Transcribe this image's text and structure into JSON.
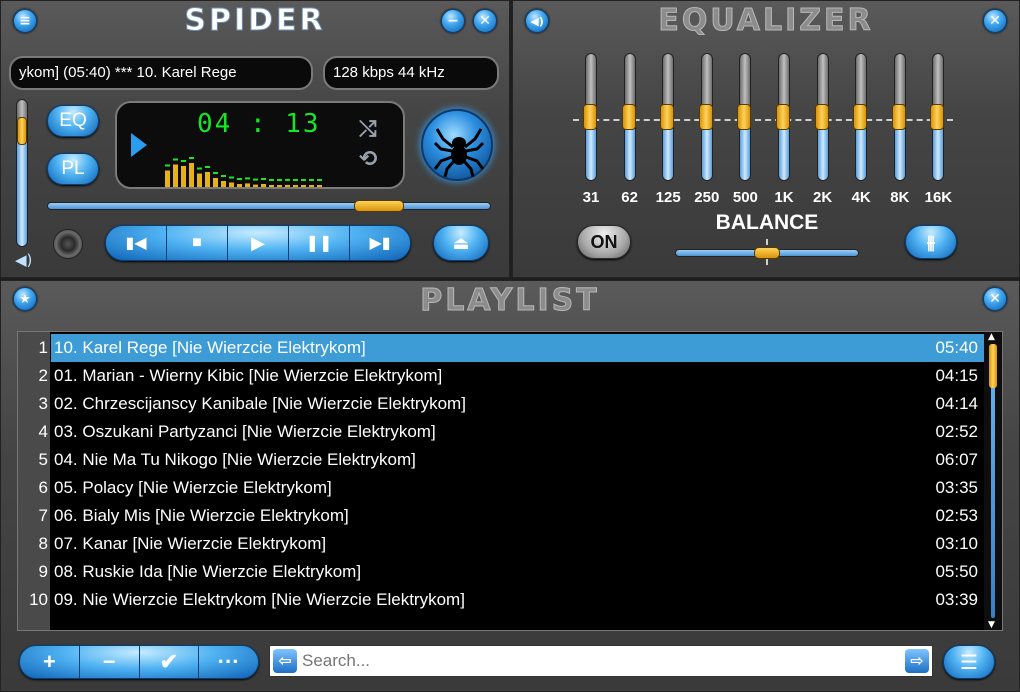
{
  "player": {
    "title": "SPIDER",
    "track_scroll": "ykom] (05:40) *** 10. Karel Rege",
    "bitrate": "128 kbps 44 kHz",
    "time": "04 : 13",
    "eq_button": "EQ",
    "pl_button": "PL",
    "seek_position": 0.78,
    "volume": 0.85,
    "spectrum_levels": [
      0.55,
      0.75,
      0.7,
      0.8,
      0.45,
      0.5,
      0.3,
      0.2,
      0.15,
      0.1,
      0.12,
      0.08,
      0.1,
      0.06,
      0.05,
      0.07,
      0.05,
      0.04,
      0.05,
      0.04
    ],
    "accent_color": "#2b9cf0",
    "time_color": "#18e52a"
  },
  "equalizer": {
    "title": "EQUALIZER",
    "bands": [
      {
        "label": "31",
        "level": 0.5
      },
      {
        "label": "62",
        "level": 0.5
      },
      {
        "label": "125",
        "level": 0.5
      },
      {
        "label": "250",
        "level": 0.5
      },
      {
        "label": "500",
        "level": 0.5
      },
      {
        "label": "1K",
        "level": 0.5
      },
      {
        "label": "2K",
        "level": 0.5
      },
      {
        "label": "4K",
        "level": 0.5
      },
      {
        "label": "8K",
        "level": 0.5
      },
      {
        "label": "16K",
        "level": 0.5
      }
    ],
    "on_button": "ON",
    "balance_label": "BALANCE",
    "balance": 0.5
  },
  "playlist": {
    "title": "PLAYLIST",
    "items": [
      {
        "num": "1",
        "title": "10. Karel Rege [Nie Wierzcie Elektrykom]",
        "time": "05:40",
        "selected": true
      },
      {
        "num": "2",
        "title": "01. Marian - Wierny Kibic [Nie Wierzcie Elektrykom]",
        "time": "04:15"
      },
      {
        "num": "3",
        "title": "02. Chrzescijanscy Kanibale [Nie Wierzcie Elektrykom]",
        "time": "04:14"
      },
      {
        "num": "4",
        "title": "03. Oszukani Partyzanci [Nie Wierzcie Elektrykom]",
        "time": "02:52"
      },
      {
        "num": "5",
        "title": "04. Nie Ma Tu Nikogo [Nie Wierzcie Elektrykom]",
        "time": "06:07"
      },
      {
        "num": "6",
        "title": "05. Polacy [Nie Wierzcie Elektrykom]",
        "time": "03:35"
      },
      {
        "num": "7",
        "title": "06. Bialy Mis [Nie Wierzcie Elektrykom]",
        "time": "02:53"
      },
      {
        "num": "8",
        "title": "07. Kanar [Nie Wierzcie Elektrykom]",
        "time": "03:10"
      },
      {
        "num": "9",
        "title": "08. Ruskie Ida [Nie Wierzcie Elektrykom]",
        "time": "05:50"
      },
      {
        "num": "10",
        "title": "09. Nie Wierzcie Elektrykom [Nie Wierzcie Elektrykom]",
        "time": "03:39"
      }
    ],
    "search_placeholder": "Search...",
    "selected_color": "#3d9bd6",
    "scroll_position": 0.0
  }
}
